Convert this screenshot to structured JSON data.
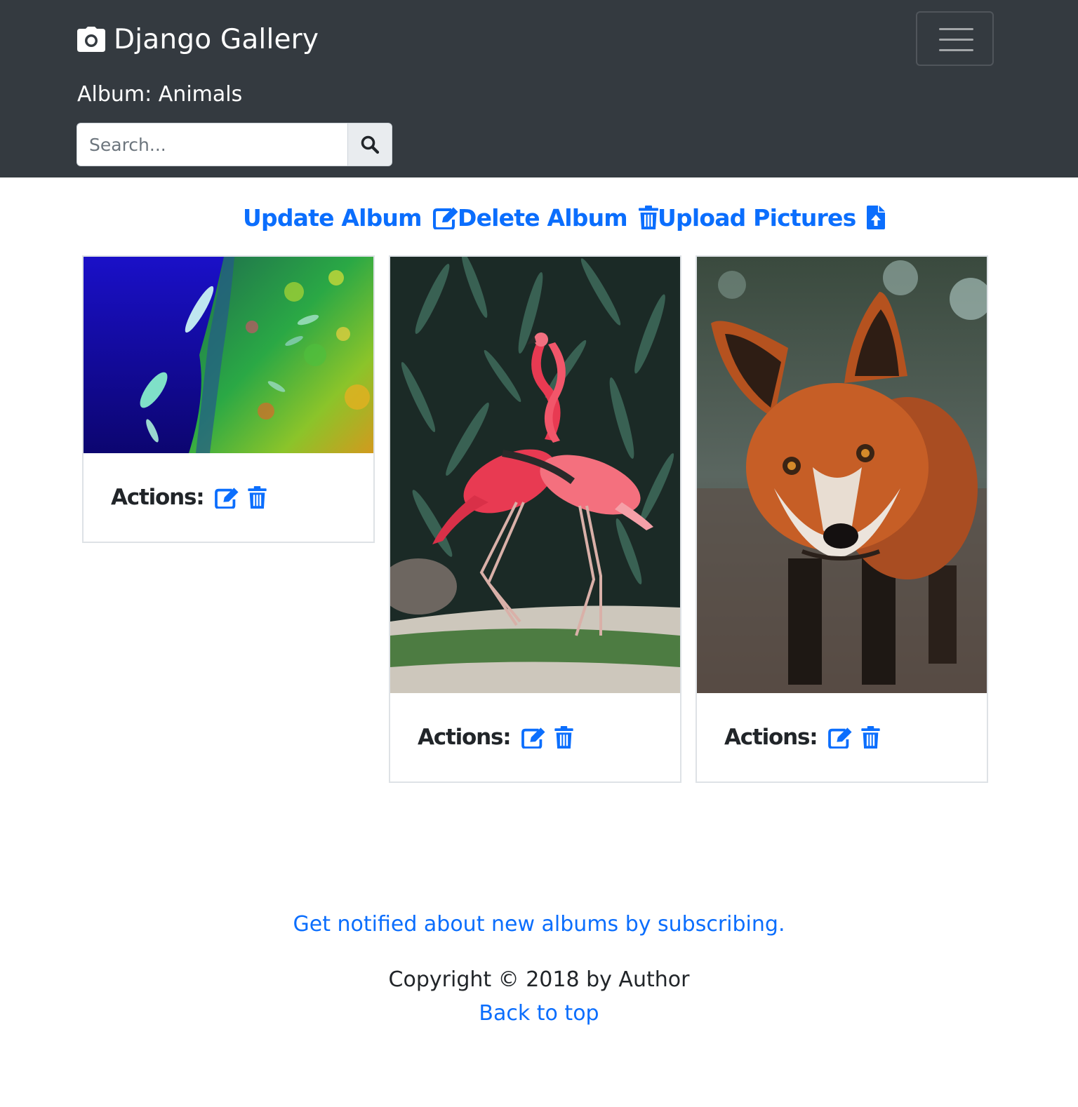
{
  "navbar": {
    "brand": "Django Gallery",
    "brand_icon": "camera-icon",
    "menu_icon": "hamburger-icon",
    "background": "#343a40"
  },
  "album": {
    "title": "Album: Animals"
  },
  "search": {
    "placeholder": "Search...",
    "icon": "search-icon"
  },
  "album_actions": {
    "update_label": "Update Album",
    "delete_label": "Delete Album",
    "upload_label": "Upload Pictures",
    "accent": "#0b6efd"
  },
  "pictures": [
    {
      "subject": "fish",
      "actions_label": "Actions:"
    },
    {
      "subject": "flamingos",
      "actions_label": "Actions:"
    },
    {
      "subject": "fox",
      "actions_label": "Actions:"
    }
  ],
  "footer": {
    "subscribe_text": "Get notified about new albums by subscribing.",
    "copyright": "Copyright © 2018 by Author",
    "back_to_top": "Back to top"
  }
}
